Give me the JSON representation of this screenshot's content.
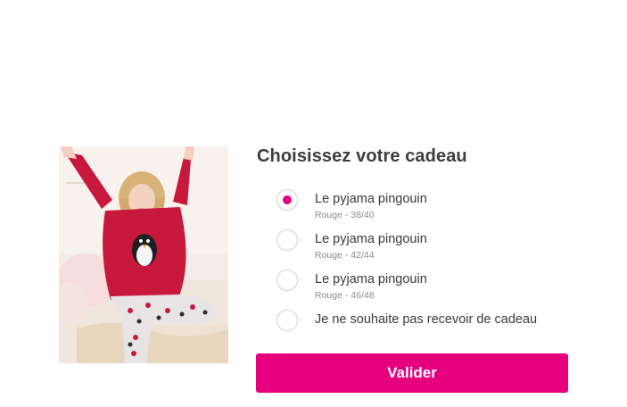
{
  "gift_picker": {
    "title": "Choisissez votre cadeau",
    "product_image_alt": "pyjama pingouin",
    "options": [
      {
        "label": "Le pyjama pingouin",
        "sub": "Rouge - 38/40",
        "selected": true
      },
      {
        "label": "Le pyjama pingouin",
        "sub": "Rouge - 42/44",
        "selected": false
      },
      {
        "label": "Le pyjama pingouin",
        "sub": "Rouge - 46/48",
        "selected": false
      },
      {
        "label": "Je ne souhaite pas recevoir de cadeau",
        "sub": "",
        "selected": false
      }
    ],
    "submit_label": "Valider"
  },
  "colors": {
    "accent": "#e6007e",
    "pyjama_red": "#c8193c",
    "text": "#3a3a3a",
    "subtext": "#8a8a8a"
  },
  "icons": {
    "radio_selected": "radio-selected-icon",
    "radio_unselected": "radio-unselected-icon"
  }
}
